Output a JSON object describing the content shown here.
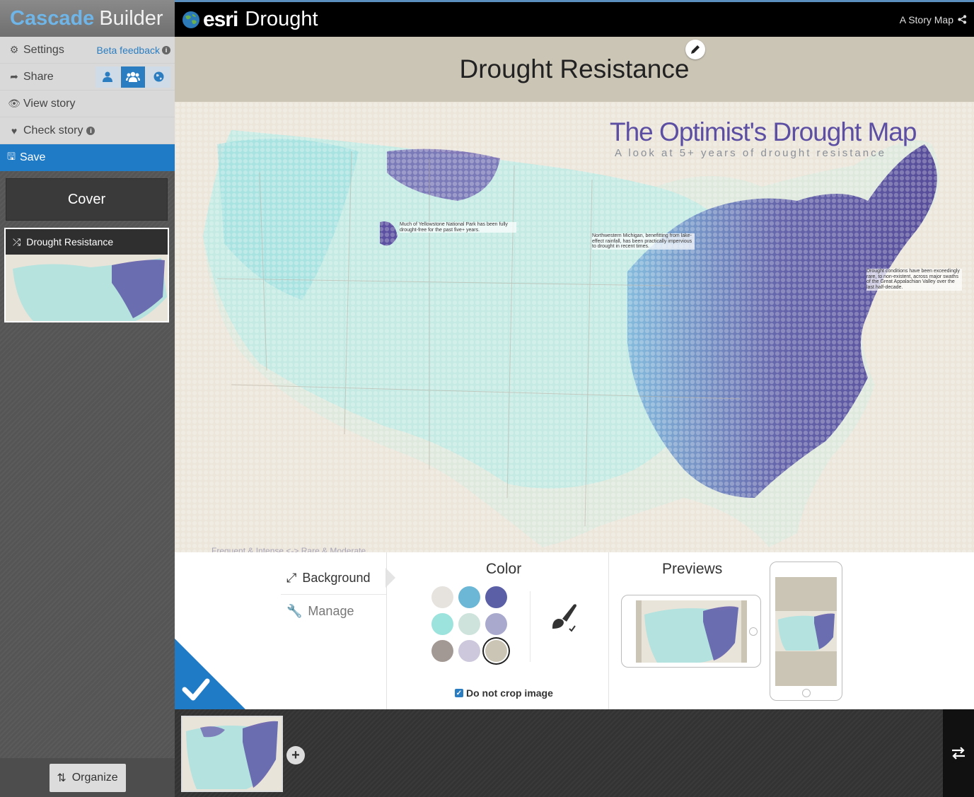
{
  "brand": {
    "part1": "Cascade",
    "part2": "Builder"
  },
  "menu": {
    "settings": "Settings",
    "beta_feedback": "Beta feedback",
    "share": "Share",
    "view_story": "View story",
    "check_story": "Check story",
    "save": "Save"
  },
  "sections": {
    "cover": "Cover",
    "current": "Drought Resistance"
  },
  "organize": "Organize",
  "topbar": {
    "logo": "esri",
    "title": "Drought",
    "story_link": "A Story Map"
  },
  "title_band": {
    "title": "Drought Resistance"
  },
  "map": {
    "heading": "The Optimist's Drought Map",
    "subheading": "A look at 5+ years of drought resistance",
    "annotations": [
      "Much of Yellowstone National Park has been fully drought-free for the past five+ years.",
      "Northwestern Michigan, benefitting from lake-effect rainfall, has been practically impervious to drought in recent times.",
      "Drought conditions have been exceedingly rare, to non-existent, across major swaths of the Great Appalachian Valley over the last half-decade."
    ],
    "legend": "Frequent & Intense  <->  Rare & Moderate"
  },
  "panel": {
    "tab_background": "Background",
    "tab_manage": "Manage",
    "color_title": "Color",
    "previews_title": "Previews",
    "do_not_crop": "Do not crop image",
    "swatches": [
      "#e6e3de",
      "#6cb7d6",
      "#5a5fa6",
      "#9be3dc",
      "#cde3dc",
      "#a8a9cc",
      "#a39994",
      "#cdc8dc",
      "#cbc5b6"
    ],
    "selected_swatch": "#cbc5b6"
  },
  "colors": {
    "accent": "#1f7bc6",
    "title_band": "#cbc5b6",
    "sidebar_menu": "#d9d9d9"
  }
}
